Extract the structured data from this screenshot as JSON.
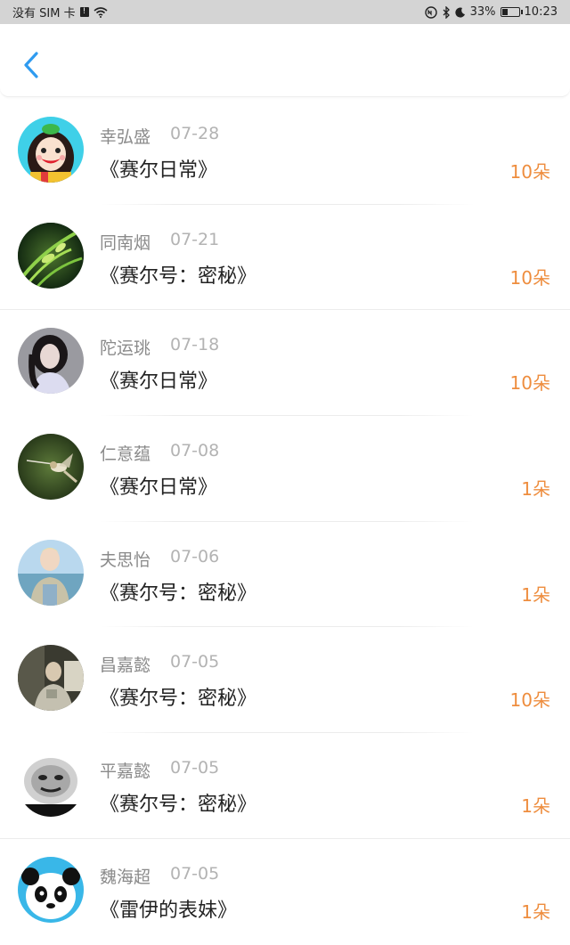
{
  "status_bar": {
    "carrier": "没有 SIM 卡",
    "battery": "33%",
    "battery_level": 0.33,
    "time": "10:23",
    "icons": [
      "sim-alert-icon",
      "wifi-icon",
      "nfc-icon",
      "bluetooth-icon",
      "moon-icon",
      "battery-icon"
    ]
  },
  "header": {
    "back_icon": "chevron-left-icon",
    "accent_color": "#2f9bf0"
  },
  "records": [
    {
      "name": "幸弘盛",
      "date": "07-28",
      "title": "《赛尔日常》",
      "gift": "10朵",
      "avatar": "cartoon-girl"
    },
    {
      "name": "同南烟",
      "date": "07-21",
      "title": "《赛尔号：密秘》",
      "gift": "10朵",
      "avatar": "green-plant"
    },
    {
      "name": "陀运珧",
      "date": "07-18",
      "title": "《赛尔日常》",
      "gift": "10朵",
      "avatar": "girl-photo"
    },
    {
      "name": "仁意蕴",
      "date": "07-08",
      "title": "《赛尔日常》",
      "gift": "1朵",
      "avatar": "hummingbird"
    },
    {
      "name": "夫思怡",
      "date": "07-06",
      "title": "《赛尔号：密秘》",
      "gift": "1朵",
      "avatar": "boy-beach"
    },
    {
      "name": "昌嘉懿",
      "date": "07-05",
      "title": "《赛尔号：密秘》",
      "gift": "10朵",
      "avatar": "boy-room"
    },
    {
      "name": "平嘉懿",
      "date": "07-05",
      "title": "《赛尔号：密秘》",
      "gift": "1朵",
      "avatar": "meme-face"
    },
    {
      "name": "魏海超",
      "date": "07-05",
      "title": "《雷伊的表妹》",
      "gift": "1朵",
      "avatar": "panda"
    }
  ],
  "colors": {
    "gift": "#ee8d3e",
    "name": "#8a8a8a",
    "date": "#b3b3b3",
    "title": "#222222"
  }
}
